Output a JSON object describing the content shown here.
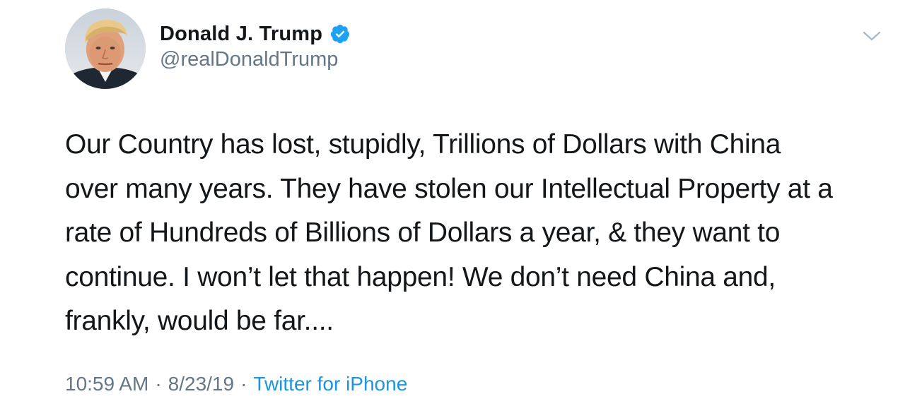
{
  "author": {
    "display_name": "Donald J. Trump",
    "handle": "@realDonaldTrump",
    "verified_icon": "verified-badge-icon",
    "avatar": "profile-photo"
  },
  "menu_icon": "chevron-down-icon",
  "tweet": {
    "lines": [
      "Our Country has lost, stupidly, Trillions of Dollars with China",
      "over many years. They have stolen our Intellectual Property at a",
      "rate of Hundreds of Billions of Dollars a year, & they want to",
      "continue. I won’t let that happen! We don’t need China and,",
      "frankly, would be far...."
    ]
  },
  "meta": {
    "time": "10:59 AM",
    "separator": "·",
    "date": "8/23/19",
    "source": "Twitter for iPhone"
  },
  "colors": {
    "text": "#14171a",
    "secondary": "#657786",
    "link": "#1b95e0",
    "verified": "#1da1f2"
  }
}
